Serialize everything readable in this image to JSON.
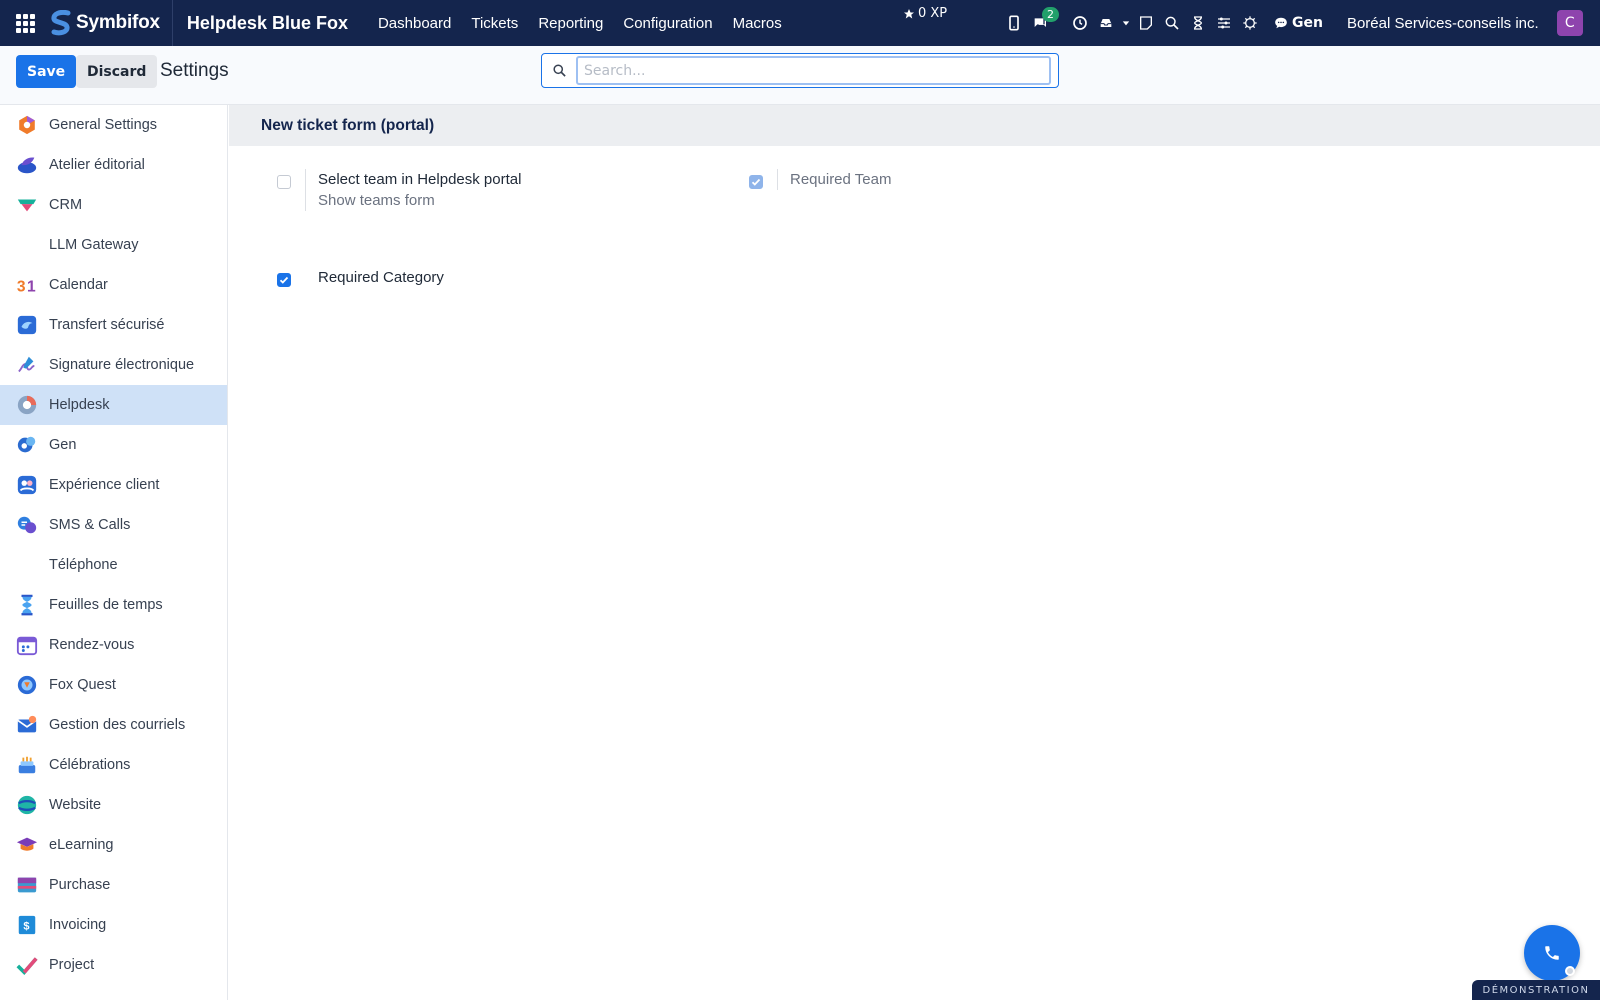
{
  "navbar": {
    "brand": "Symbifox",
    "app_name": "Helpdesk Blue Fox",
    "menu": [
      "Dashboard",
      "Tickets",
      "Reporting",
      "Configuration",
      "Macros"
    ],
    "xp": "0 XP",
    "chat_badge": "2",
    "gen_label": "Gen",
    "company": "Boréal Services-conseils inc.",
    "avatar_initial": "C"
  },
  "control_panel": {
    "save_label": "Save",
    "discard_label": "Discard",
    "title": "Settings",
    "search_placeholder": "Search..."
  },
  "sidebar": {
    "active_index": 7,
    "items": [
      {
        "label": "General Settings",
        "icon": "general-settings-icon"
      },
      {
        "label": "Atelier éditorial",
        "icon": "atelier-editorial-icon"
      },
      {
        "label": "CRM",
        "icon": "crm-icon"
      },
      {
        "label": "LLM Gateway",
        "icon": ""
      },
      {
        "label": "Calendar",
        "icon": "calendar-icon"
      },
      {
        "label": "Transfert sécurisé",
        "icon": "transfert-securise-icon"
      },
      {
        "label": "Signature électronique",
        "icon": "signature-icon"
      },
      {
        "label": "Helpdesk",
        "icon": "helpdesk-icon"
      },
      {
        "label": "Gen",
        "icon": "gen-icon"
      },
      {
        "label": "Expérience client",
        "icon": "experience-client-icon"
      },
      {
        "label": "SMS & Calls",
        "icon": "sms-calls-icon"
      },
      {
        "label": "Téléphone",
        "icon": ""
      },
      {
        "label": "Feuilles de temps",
        "icon": "timesheet-icon"
      },
      {
        "label": "Rendez-vous",
        "icon": "appointment-icon"
      },
      {
        "label": "Fox Quest",
        "icon": "fox-quest-icon"
      },
      {
        "label": "Gestion des courriels",
        "icon": "email-management-icon"
      },
      {
        "label": "Célébrations",
        "icon": "celebrations-icon"
      },
      {
        "label": "Website",
        "icon": "website-icon"
      },
      {
        "label": "eLearning",
        "icon": "elearning-icon"
      },
      {
        "label": "Purchase",
        "icon": "purchase-icon"
      },
      {
        "label": "Invoicing",
        "icon": "invoicing-icon"
      },
      {
        "label": "Project",
        "icon": "project-icon"
      }
    ]
  },
  "content": {
    "section_title": "New ticket form (portal)",
    "settings": {
      "select_team": {
        "title": "Select team in Helpdesk portal",
        "description": "Show teams form",
        "checked": false
      },
      "required_team": {
        "title": "Required Team",
        "checked": true,
        "readonly": true
      },
      "required_category": {
        "title": "Required Category",
        "checked": true
      }
    }
  },
  "footer": {
    "demo_ribbon": "DÉMONSTRATION"
  },
  "colors": {
    "navbar_bg": "#14254d",
    "primary": "#1a73e8",
    "active_sidebar": "#cfe1f7",
    "section_header_bg": "#eceef1",
    "avatar_bg": "#8e44ad",
    "badge_bg": "#22a06b"
  }
}
